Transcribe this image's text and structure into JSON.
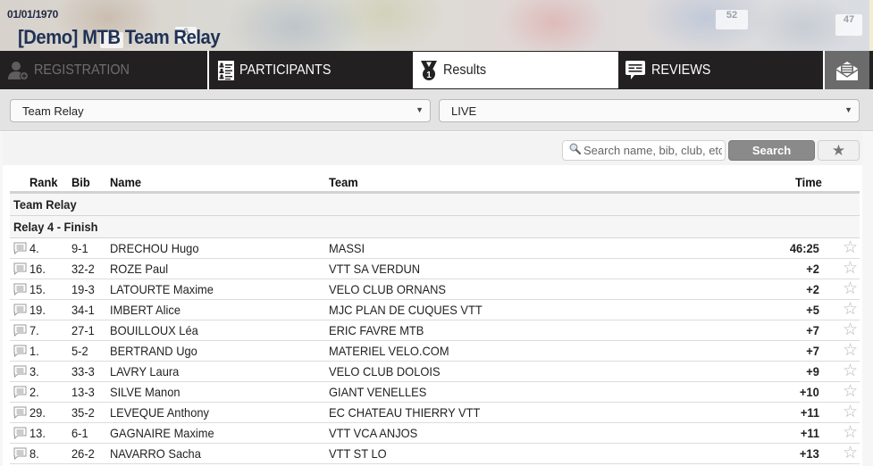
{
  "header": {
    "date": "01/01/1970",
    "title": "[Demo] MTB Team Relay",
    "banner_bibs": [
      "1",
      "6",
      "52",
      "47"
    ]
  },
  "nav": {
    "tabs": [
      {
        "label": "REGISTRATION",
        "icon": "add-user-icon",
        "state": "disabled"
      },
      {
        "label": "PARTICIPANTS",
        "icon": "participants-list-icon",
        "state": "normal"
      },
      {
        "label": "Results",
        "icon": "medal-icon",
        "state": "active"
      },
      {
        "label": "REVIEWS",
        "icon": "chat-icon",
        "state": "normal"
      },
      {
        "label": "",
        "icon": "envelope-icon",
        "state": "normal"
      }
    ]
  },
  "filters": {
    "category": {
      "selected": "Team Relay"
    },
    "status": {
      "selected": "LIVE"
    }
  },
  "search": {
    "placeholder": "Search name, bib, club, etc",
    "value": "",
    "button_label": "Search",
    "favorites_icon": "star-icon"
  },
  "table": {
    "columns": [
      "Rank",
      "Bib",
      "Name",
      "Team",
      "Time"
    ],
    "group": "Team Relay",
    "subgroup": "Relay 4 - Finish",
    "rows": [
      {
        "rank": "4.",
        "bib": "9-1",
        "name": "DRECHOU Hugo",
        "team": "MASSI",
        "time": "46:25"
      },
      {
        "rank": "16.",
        "bib": "32-2",
        "name": "ROZE Paul",
        "team": "VTT SA VERDUN",
        "time": "+2"
      },
      {
        "rank": "15.",
        "bib": "19-3",
        "name": "LATOURTE Maxime",
        "team": "VELO CLUB ORNANS",
        "time": "+2"
      },
      {
        "rank": "19.",
        "bib": "34-1",
        "name": "IMBERT Alice",
        "team": "MJC PLAN DE CUQUES VTT",
        "time": "+5"
      },
      {
        "rank": "7.",
        "bib": "27-1",
        "name": "BOUILLOUX Léa",
        "team": "ERIC FAVRE MTB",
        "time": "+7"
      },
      {
        "rank": "1.",
        "bib": "5-2",
        "name": "BERTRAND Ugo",
        "team": "MATERIEL VELO.COM",
        "time": "+7"
      },
      {
        "rank": "3.",
        "bib": "33-3",
        "name": "LAVRY Laura",
        "team": "VELO CLUB DOLOIS",
        "time": "+9"
      },
      {
        "rank": "2.",
        "bib": "13-3",
        "name": "SILVE Manon",
        "team": "GIANT VENELLES",
        "time": "+10"
      },
      {
        "rank": "29.",
        "bib": "35-2",
        "name": "LEVEQUE Anthony",
        "team": "EC CHATEAU THIERRY VTT",
        "time": "+11"
      },
      {
        "rank": "13.",
        "bib": "6-1",
        "name": "GAGNAIRE Maxime",
        "team": "VTT VCA ANJOS",
        "time": "+11"
      },
      {
        "rank": "8.",
        "bib": "26-2",
        "name": "NAVARRO Sacha",
        "team": "VTT ST LO",
        "time": "+13"
      }
    ]
  },
  "colors": {
    "nav_bg": "#222020",
    "title": "#1f3256",
    "search_button": "#8a8a8a",
    "envelope_tab": "#6b6b6b"
  }
}
